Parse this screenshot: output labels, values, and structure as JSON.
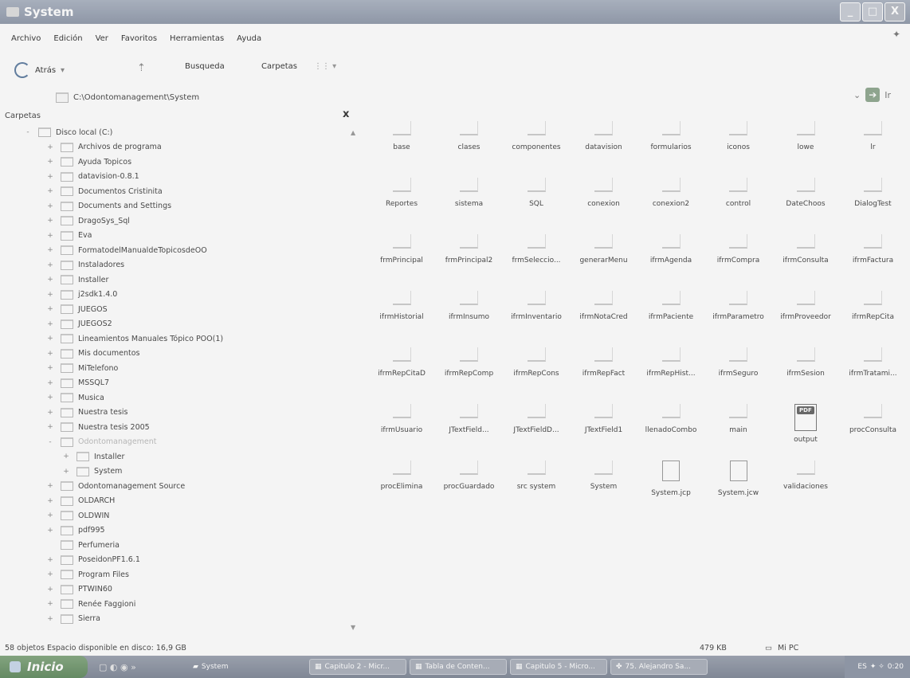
{
  "window": {
    "title": "System"
  },
  "window_buttons": [
    "_",
    "□",
    "X"
  ],
  "menu": [
    "Archivo",
    "Edición",
    "Ver",
    "Favoritos",
    "Herramientas",
    "Ayuda"
  ],
  "toolbar": {
    "back": "Atrás",
    "search": "Busqueda",
    "folders": "Carpetas"
  },
  "address": {
    "path": "C:\\Odontomanagement\\System"
  },
  "tree": {
    "header": "Carpetas",
    "close": "x",
    "nodes": [
      {
        "label": "Disco local (C:)",
        "level": 1,
        "toggle": "-"
      },
      {
        "label": "Archivos de programa",
        "level": 2,
        "toggle": "+"
      },
      {
        "label": "Ayuda Topicos",
        "level": 2,
        "toggle": "+"
      },
      {
        "label": "datavision-0.8.1",
        "level": 2,
        "toggle": "+"
      },
      {
        "label": "Documentos Cristinita",
        "level": 2,
        "toggle": "+"
      },
      {
        "label": "Documents and Settings",
        "level": 2,
        "toggle": "+"
      },
      {
        "label": "DragoSys_Sql",
        "level": 2,
        "toggle": "+"
      },
      {
        "label": "Eva",
        "level": 2,
        "toggle": "+"
      },
      {
        "label": "FormatodelManualdeTopicosdeOO",
        "level": 2,
        "toggle": "+"
      },
      {
        "label": "Instaladores",
        "level": 2,
        "toggle": "+"
      },
      {
        "label": "Installer",
        "level": 2,
        "toggle": "+"
      },
      {
        "label": "j2sdk1.4.0",
        "level": 2,
        "toggle": "+"
      },
      {
        "label": "JUEGOS",
        "level": 2,
        "toggle": "+"
      },
      {
        "label": "JUEGOS2",
        "level": 2,
        "toggle": "+"
      },
      {
        "label": "Lineamientos Manuales Tópico POO(1)",
        "level": 2,
        "toggle": "+"
      },
      {
        "label": "Mis documentos",
        "level": 2,
        "toggle": "+"
      },
      {
        "label": "MiTelefono",
        "level": 2,
        "toggle": "+"
      },
      {
        "label": "MSSQL7",
        "level": 2,
        "toggle": "+"
      },
      {
        "label": "Musica",
        "level": 2,
        "toggle": "+"
      },
      {
        "label": "Nuestra tesis",
        "level": 2,
        "toggle": "+"
      },
      {
        "label": "Nuestra tesis 2005",
        "level": 2,
        "toggle": "+"
      },
      {
        "label": "Odontomanagement",
        "level": 2,
        "toggle": "-",
        "selected": true
      },
      {
        "label": "Installer",
        "level": 3,
        "toggle": "+"
      },
      {
        "label": "System",
        "level": 3,
        "toggle": "+"
      },
      {
        "label": "Odontomanagement Source",
        "level": 2,
        "toggle": "+"
      },
      {
        "label": "OLDARCH",
        "level": 2,
        "toggle": "+"
      },
      {
        "label": "OLDWIN",
        "level": 2,
        "toggle": "+"
      },
      {
        "label": "pdf995",
        "level": 2,
        "toggle": "+"
      },
      {
        "label": "Perfumeria",
        "level": 2,
        "toggle": ""
      },
      {
        "label": "PoseidonPF1.6.1",
        "level": 2,
        "toggle": "+"
      },
      {
        "label": "Program Files",
        "level": 2,
        "toggle": "+"
      },
      {
        "label": "PTWIN60",
        "level": 2,
        "toggle": "+"
      },
      {
        "label": "Renée Faggioni",
        "level": 2,
        "toggle": "+"
      },
      {
        "label": "Sierra",
        "level": 2,
        "toggle": "+"
      }
    ]
  },
  "files": [
    {
      "name": "base",
      "icon": "folder"
    },
    {
      "name": "clases",
      "icon": "folder"
    },
    {
      "name": "componentes",
      "icon": "folder"
    },
    {
      "name": "datavision",
      "icon": "folder"
    },
    {
      "name": "formularios",
      "icon": "folder"
    },
    {
      "name": "iconos",
      "icon": "folder"
    },
    {
      "name": "lowe",
      "icon": "folder"
    },
    {
      "name": "lr",
      "icon": "folder"
    },
    {
      "name": "Reportes",
      "icon": "folder"
    },
    {
      "name": "sistema",
      "icon": "folder"
    },
    {
      "name": "SQL",
      "icon": "folder"
    },
    {
      "name": "conexion",
      "icon": "file"
    },
    {
      "name": "conexion2",
      "icon": "file"
    },
    {
      "name": "control",
      "icon": "file"
    },
    {
      "name": "DateChoos",
      "icon": "file"
    },
    {
      "name": "DialogTest",
      "icon": "file"
    },
    {
      "name": "frmPrincipal",
      "icon": "file"
    },
    {
      "name": "frmPrincipal2",
      "icon": "file"
    },
    {
      "name": "frmSeleccio...",
      "icon": "file"
    },
    {
      "name": "generarMenu",
      "icon": "file"
    },
    {
      "name": "ifrmAgenda",
      "icon": "file"
    },
    {
      "name": "ifrmCompra",
      "icon": "file"
    },
    {
      "name": "ifrmConsulta",
      "icon": "file"
    },
    {
      "name": "ifrmFactura",
      "icon": "file"
    },
    {
      "name": "ifrmHistorial",
      "icon": "file"
    },
    {
      "name": "ifrmInsumo",
      "icon": "file"
    },
    {
      "name": "ifrmInventario",
      "icon": "file"
    },
    {
      "name": "ifrmNotaCred",
      "icon": "file"
    },
    {
      "name": "ifrmPaciente",
      "icon": "file"
    },
    {
      "name": "ifrmParametro",
      "icon": "file"
    },
    {
      "name": "ifrmProveedor",
      "icon": "file"
    },
    {
      "name": "ifrmRepCita",
      "icon": "file"
    },
    {
      "name": "ifrmRepCitaD",
      "icon": "file"
    },
    {
      "name": "ifrmRepComp",
      "icon": "file"
    },
    {
      "name": "ifrmRepCons",
      "icon": "file"
    },
    {
      "name": "ifrmRepFact",
      "icon": "file"
    },
    {
      "name": "ifrmRepHist...",
      "icon": "file"
    },
    {
      "name": "ifrmSeguro",
      "icon": "file"
    },
    {
      "name": "ifrmSesion",
      "icon": "file"
    },
    {
      "name": "ifrmTratami...",
      "icon": "file"
    },
    {
      "name": "ifrmUsuario",
      "icon": "file"
    },
    {
      "name": "JTextField...",
      "icon": "file"
    },
    {
      "name": "JTextFieldD...",
      "icon": "file"
    },
    {
      "name": "JTextField1",
      "icon": "file"
    },
    {
      "name": "llenadoCombo",
      "icon": "file"
    },
    {
      "name": "main",
      "icon": "file"
    },
    {
      "name": "output",
      "icon": "pdf"
    },
    {
      "name": "procConsulta",
      "icon": "file"
    },
    {
      "name": "procElimina",
      "icon": "file"
    },
    {
      "name": "procGuardado",
      "icon": "file"
    },
    {
      "name": "src system",
      "icon": "file"
    },
    {
      "name": "System",
      "icon": "file"
    },
    {
      "name": "System.jcp",
      "icon": "page"
    },
    {
      "name": "System.jcw",
      "icon": "page"
    },
    {
      "name": "validaciones",
      "icon": "file"
    }
  ],
  "status": {
    "objects": "58 objetos  Espacio disponible en disco: 16,9 GB",
    "size": "479 KB",
    "location": "Mi PC"
  },
  "taskbar": {
    "start": "Inicio",
    "active_window": "System",
    "tasks": [
      "Capitulo 2 - Micr...",
      "Tabla de Conten...",
      "Capitulo 5 - Micro...",
      "75. Alejandro Sa..."
    ],
    "lang": "ES",
    "clock": "0:20"
  }
}
